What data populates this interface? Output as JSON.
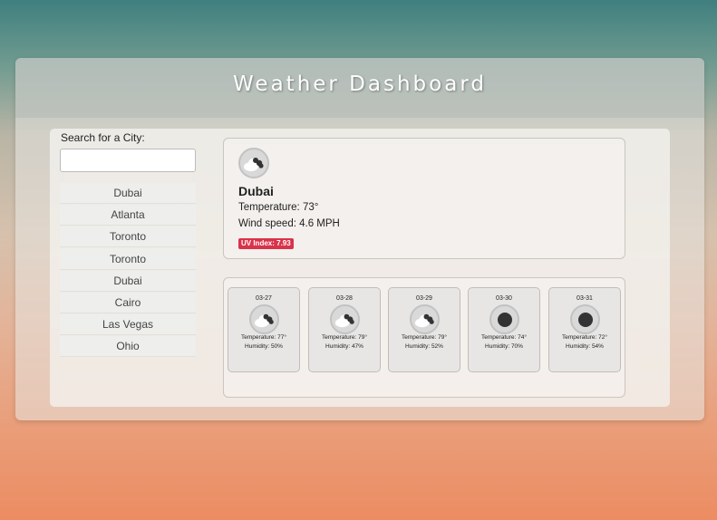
{
  "header": {
    "title": "Weather Dashboard"
  },
  "search": {
    "label": "Search for a City:",
    "placeholder": "",
    "value": ""
  },
  "history": [
    "Dubai",
    "Atlanta",
    "Toronto",
    "Toronto",
    "Dubai",
    "Cairo",
    "Las Vegas",
    "Ohio"
  ],
  "current": {
    "icon": "cloud-icon",
    "city": "Dubai",
    "temperature": "Temperature: 73°",
    "wind": "Wind speed: 4.6 MPH",
    "uv": "UV Index: 7.93",
    "uv_color": "#d9334a"
  },
  "forecast": [
    {
      "date": "03-27",
      "icon": "cloud-icon",
      "temperature": "Temperature: 77°",
      "humidity": "Humidity: 50%"
    },
    {
      "date": "03-28",
      "icon": "cloud-icon",
      "temperature": "Temperature: 79°",
      "humidity": "Humidity: 47%"
    },
    {
      "date": "03-29",
      "icon": "cloud-icon",
      "temperature": "Temperature: 79°",
      "humidity": "Humidity: 52%"
    },
    {
      "date": "03-30",
      "icon": "dark-circle-icon",
      "temperature": "Temperature: 74°",
      "humidity": "Humidity: 70%"
    },
    {
      "date": "03-31",
      "icon": "dark-circle-icon",
      "temperature": "Temperature: 72°",
      "humidity": "Humidity: 54%"
    }
  ]
}
